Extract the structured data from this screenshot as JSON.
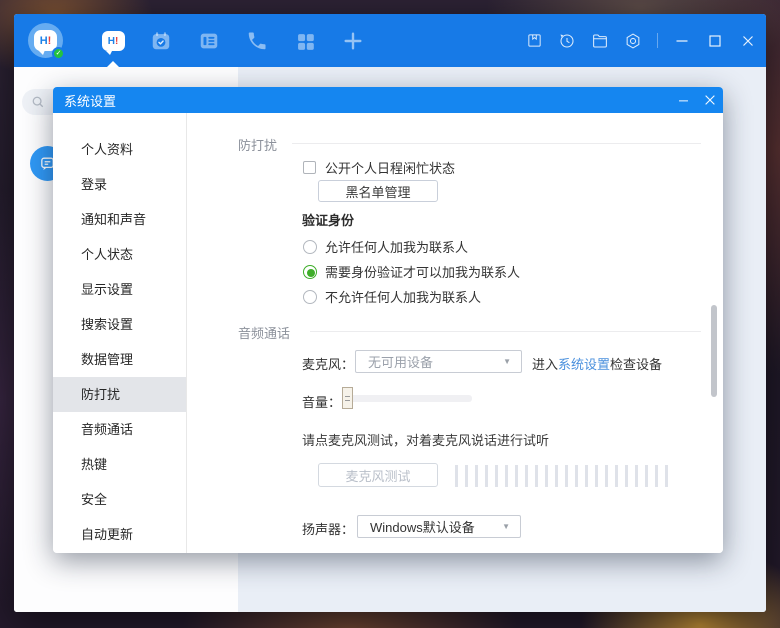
{
  "colors": {
    "titlebar_blue": "#177ae7",
    "dialog_header_blue": "#1586f0",
    "accent_green": "#3fae2a",
    "badge_green": "#23c33f",
    "link_blue": "#4a90dd",
    "selected_item_bg": "#e3e5e9"
  },
  "titlebar": {
    "logo_h": "H",
    "logo_excl": "!",
    "active_tab_h": "H",
    "active_tab_excl": "!",
    "icons": [
      "avatar",
      "chat",
      "calendar",
      "notes",
      "phone",
      "apps",
      "add",
      "archive",
      "history",
      "folder",
      "settings",
      "minimize",
      "maximize",
      "close"
    ]
  },
  "dialog": {
    "title": "系统设置",
    "sidebar": {
      "items": [
        {
          "label": "个人资料",
          "selected": false
        },
        {
          "label": "登录",
          "selected": false
        },
        {
          "label": "通知和声音",
          "selected": false
        },
        {
          "label": "个人状态",
          "selected": false
        },
        {
          "label": "显示设置",
          "selected": false
        },
        {
          "label": "搜索设置",
          "selected": false
        },
        {
          "label": "数据管理",
          "selected": false
        },
        {
          "label": "防打扰",
          "selected": true
        },
        {
          "label": "音频通话",
          "selected": false
        },
        {
          "label": "热键",
          "selected": false
        },
        {
          "label": "安全",
          "selected": false
        },
        {
          "label": "自动更新",
          "selected": false
        }
      ]
    },
    "dnd": {
      "section_title": "防打扰",
      "calendar_checkbox_label": "公开个人日程闲忙状态",
      "calendar_checkbox_checked": false,
      "blacklist_button": "黑名单管理",
      "verify_title": "验证身份",
      "verify_options": [
        {
          "label": "允许任何人加我为联系人",
          "selected": false
        },
        {
          "label": "需要身份验证才可以加我为联系人",
          "selected": true
        },
        {
          "label": "不允许任何人加我为联系人",
          "selected": false
        }
      ]
    },
    "audio": {
      "section_title": "音频通话",
      "mic_label": "麦克风：",
      "mic_value": "无可用设备",
      "mic_dropdown_arrow": "▼",
      "mic_hint_prefix": "进入",
      "mic_hint_link": "系统设置",
      "mic_hint_suffix": "检查设备",
      "volume_label": "音量：",
      "volume_value": 0,
      "test_hint": "请点麦克风测试，对着麦克风说话进行试听",
      "test_button": "麦克风测试",
      "meter_bar_count": 22,
      "speaker_label": "扬声器：",
      "speaker_value": "Windows默认设备",
      "speaker_dropdown_arrow": "▼"
    }
  }
}
